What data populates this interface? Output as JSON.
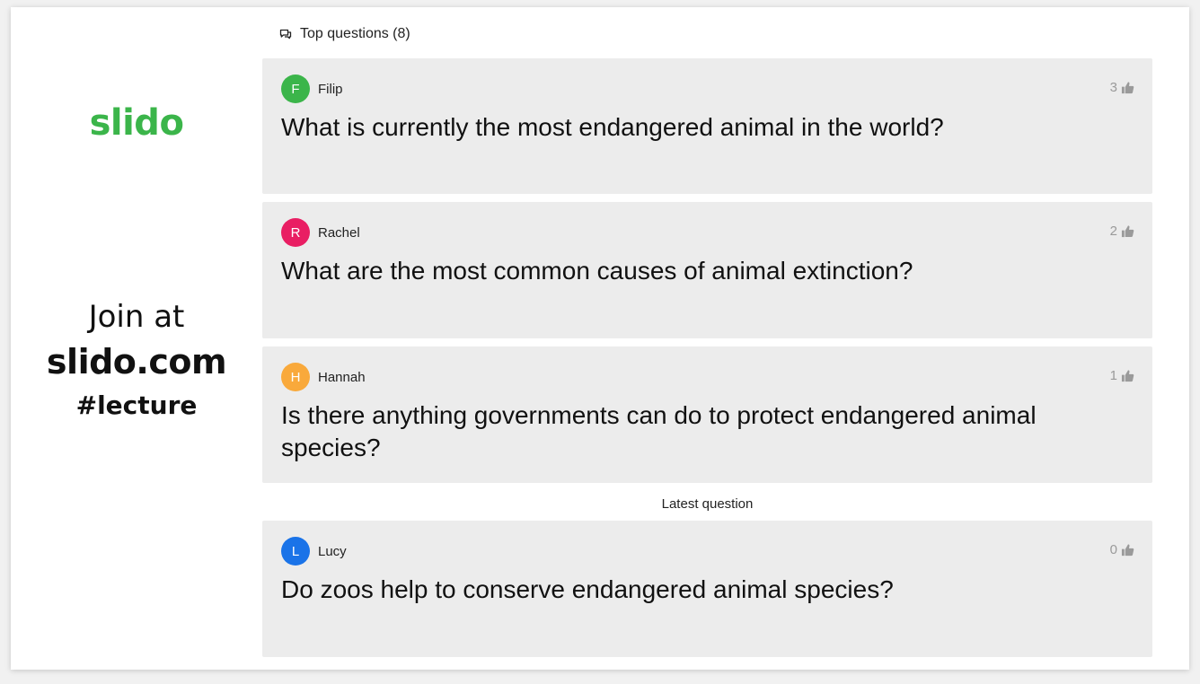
{
  "brand": {
    "logo_text": "slido",
    "logo_color": "#3bb54a",
    "join_text": "Join at",
    "join_url": "slido.com",
    "event_code": "#lecture"
  },
  "header": {
    "icon": "chat-bubbles-icon",
    "title": "Top questions (8)"
  },
  "questions": [
    {
      "author": "Filip",
      "initial": "F",
      "avatar_color": "#3bb54a",
      "likes": "3",
      "text": "What is currently the most endangered animal in the world?"
    },
    {
      "author": "Rachel",
      "initial": "R",
      "avatar_color": "#e91e63",
      "likes": "2",
      "text": "What are the most common causes of animal extinction?"
    },
    {
      "author": "Hannah",
      "initial": "H",
      "avatar_color": "#f9a93b",
      "likes": "1",
      "text": "Is there anything governments can do to protect endangered animal species?"
    }
  ],
  "latest": {
    "label": "Latest question",
    "question": {
      "author": "Lucy",
      "initial": "L",
      "avatar_color": "#1a73e8",
      "likes": "0",
      "text": "Do zoos help to conserve endangered animal species?"
    }
  },
  "icons": {
    "like": "thumbs-up-icon"
  }
}
